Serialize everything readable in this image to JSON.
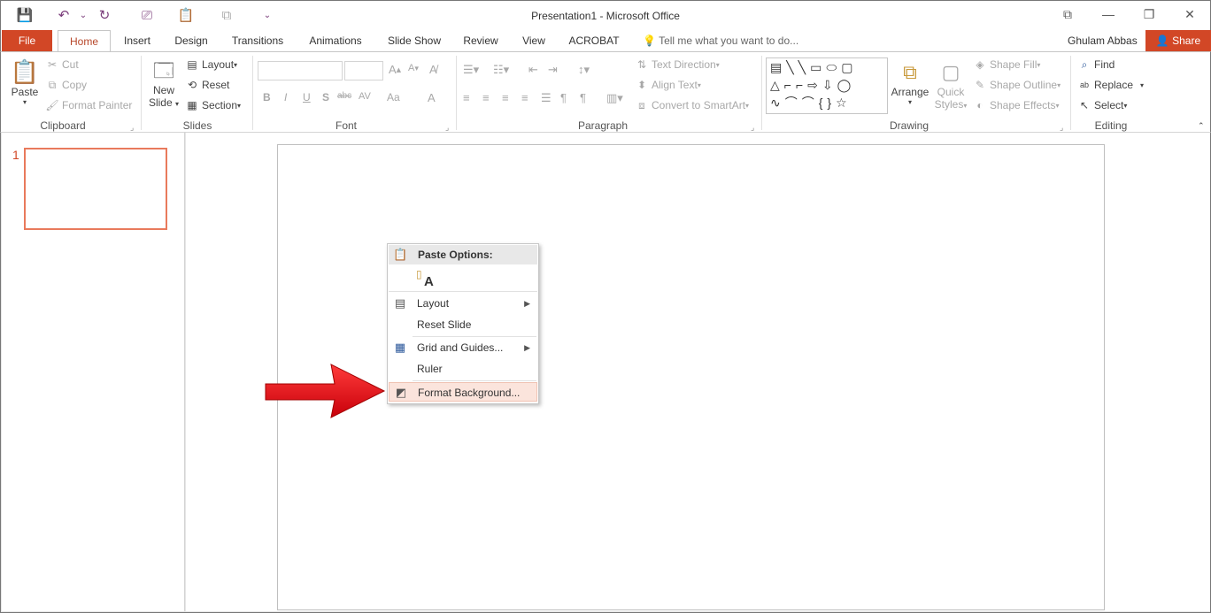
{
  "window": {
    "title": "Presentation1 - Microsoft Office",
    "controls": {
      "restore_ribbon": "⧉",
      "restore": "❐",
      "close": "✕"
    }
  },
  "qat": {
    "save_icon": "💾",
    "undo_icon": "↶",
    "redo_icon": "↻",
    "dropdown": "⌄"
  },
  "tabs": {
    "file": "File",
    "items": [
      "Home",
      "Insert",
      "Design",
      "Transitions",
      "Animations",
      "Slide Show",
      "Review",
      "View",
      "ACROBAT"
    ],
    "tellme": "Tell me what you want to do...",
    "user": "Ghulam Abbas",
    "share": "Share"
  },
  "ribbon": {
    "clipboard": {
      "paste": "Paste",
      "cut": "Cut",
      "copy": "Copy",
      "format_painter": "Format Painter",
      "label": "Clipboard"
    },
    "slides": {
      "new_slide_1": "New",
      "new_slide_2": "Slide",
      "layout": "Layout",
      "reset": "Reset",
      "section": "Section",
      "label": "Slides"
    },
    "font": {
      "label": "Font",
      "buttons": [
        "B",
        "I",
        "U",
        "S",
        "abc",
        "AV",
        "Aa",
        "A"
      ]
    },
    "paragraph": {
      "text_direction": "Text Direction",
      "align_text": "Align Text",
      "convert_smartart": "Convert to SmartArt",
      "label": "Paragraph"
    },
    "drawing": {
      "arrange": "Arrange",
      "quick_1": "Quick",
      "quick_2": "Styles",
      "shape_fill": "Shape Fill",
      "shape_outline": "Shape Outline",
      "shape_effects": "Shape Effects",
      "label": "Drawing"
    },
    "editing": {
      "find": "Find",
      "replace": "Replace",
      "select": "Select",
      "label": "Editing"
    }
  },
  "thumbnails": {
    "slide_number": "1"
  },
  "context_menu": {
    "header": "Paste Options:",
    "paste_keep_text": "A",
    "items": {
      "layout": "Layout",
      "reset_slide": "Reset Slide",
      "grid_guides": "Grid and Guides...",
      "ruler": "Ruler",
      "format_background": "Format Background..."
    }
  },
  "annotation": {
    "arrow_color": "#e8141c"
  },
  "colors": {
    "accent": "#d24726",
    "thumb_border": "#e97a5c",
    "highlight": "#fbe4dc"
  }
}
